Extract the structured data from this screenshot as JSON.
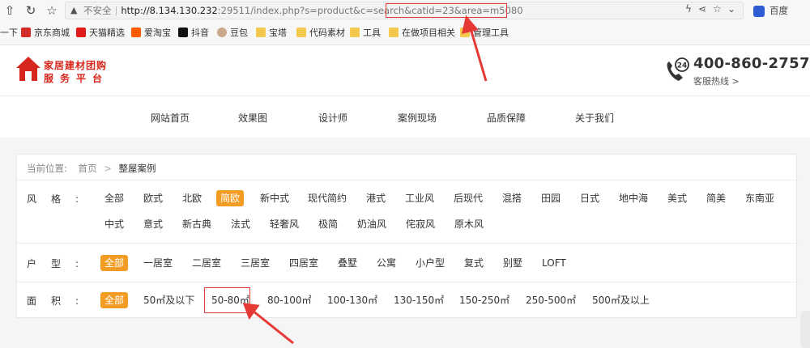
{
  "browser": {
    "insecure_label": "不安全",
    "url_host": "http://8.134.130.232",
    "url_rest": ":29511/index.php?s=product&c=search",
    "url_highlight": "&catid=23&area=m5080",
    "search_engine": "百度",
    "nav_icons": [
      "back-icon",
      "reload-icon",
      "star-icon",
      "warning-icon"
    ],
    "bookmarks": [
      "一下",
      "京东商城",
      "天猫精选",
      "爱淘宝",
      "抖音",
      "豆包",
      "宝塔",
      "代码素材",
      "工具",
      "在做项目相关",
      "管理工具"
    ]
  },
  "header": {
    "logo_line1": "家居建材团购",
    "logo_line2": "服务平台",
    "hotline": "400-860-2757",
    "hotline_label": "客服热线 >",
    "hotline_badge": "24"
  },
  "nav": [
    "网站首页",
    "效果图",
    "设计师",
    "案例现场",
    "品质保障",
    "关于我们"
  ],
  "breadcrumb": {
    "label": "当前位置:",
    "home": "首页",
    "current": "整屋案例"
  },
  "filters": {
    "style": {
      "label": "风格:",
      "options": [
        "全部",
        "欧式",
        "北欧",
        "简欧",
        "新中式",
        "现代简约",
        "港式",
        "工业风",
        "后现代",
        "混搭",
        "田园",
        "日式",
        "地中海",
        "美式",
        "简美",
        "东南亚",
        "中式",
        "意式",
        "新古典",
        "法式",
        "轻奢风",
        "极简",
        "奶油风",
        "侘寂风",
        "原木风"
      ],
      "active": "简欧"
    },
    "layout": {
      "label": "户型:",
      "options": [
        "全部",
        "一居室",
        "二居室",
        "三居室",
        "四居室",
        "叠墅",
        "公寓",
        "小户型",
        "复式",
        "别墅",
        "LOFT"
      ],
      "active": "全部"
    },
    "area": {
      "label": "面积:",
      "options": [
        "全部",
        "50㎡及以下",
        "50-80㎡",
        "80-100㎡",
        "100-130㎡",
        "130-150㎡",
        "150-250㎡",
        "250-500㎡",
        "500㎡及以上"
      ],
      "active": "全部",
      "highlighted": "50-80㎡"
    }
  },
  "colors": {
    "accent": "#f39c24",
    "brand_red": "#d7261c",
    "annotation_red": "#e53935"
  }
}
